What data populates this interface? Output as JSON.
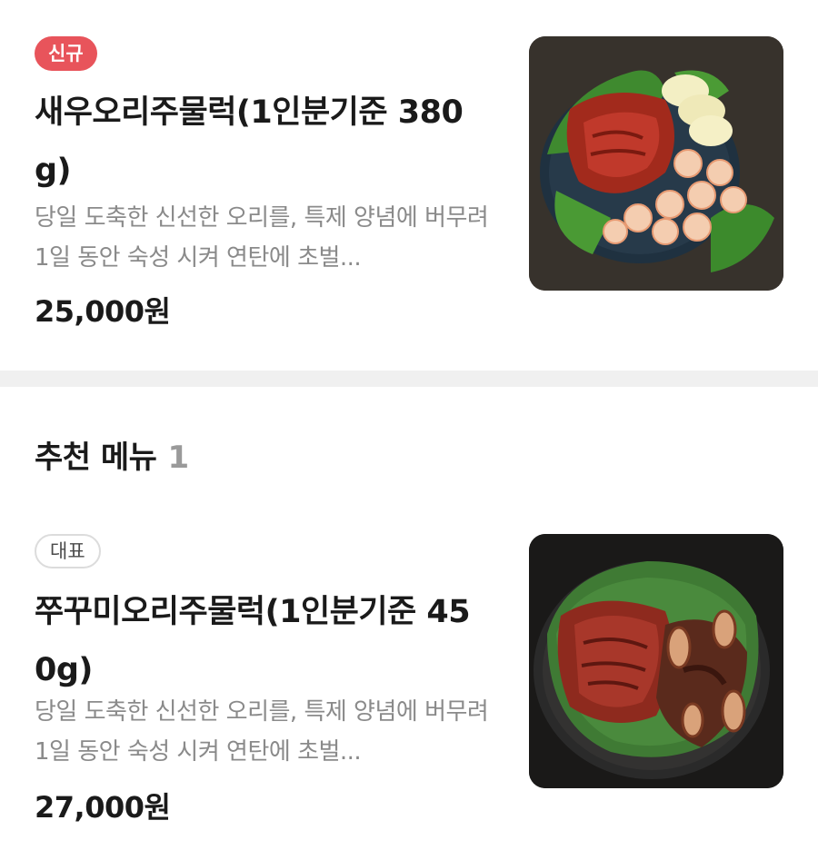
{
  "items": [
    {
      "badge": "신규",
      "name": "새우오리주물럭(1인분기준 380g)",
      "description": "당일 도축한 신선한 오리를, 특제 양념에 버무려 1일 동안 숙성 시켜 연탄에 초벌...",
      "price": "25,000원"
    },
    {
      "badge": "대표",
      "name": "쭈꾸미오리주물럭(1인분기준 450g)",
      "description": "당일 도축한 신선한 오리를, 특제 양념에 버무려 1일 동안 숙성 시켜 연탄에 초벌...",
      "price": "27,000원"
    }
  ],
  "section": {
    "title": "추천 메뉴",
    "count": "1"
  },
  "colors": {
    "new_badge": "#e8545b",
    "divider": "#f0f0f0",
    "muted_text": "#8a8a8a"
  }
}
